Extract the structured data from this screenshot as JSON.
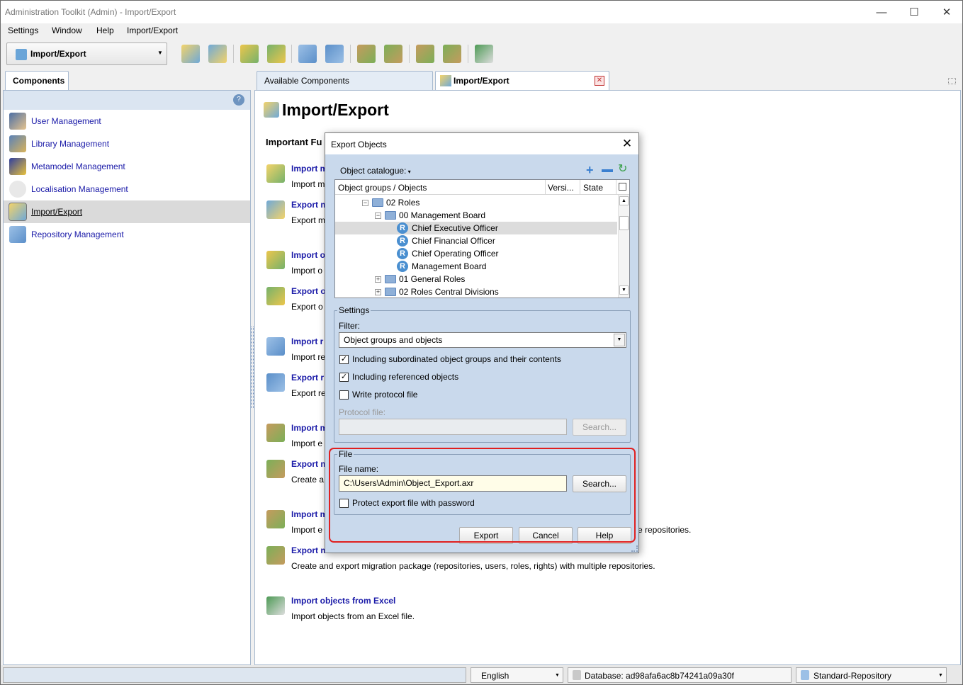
{
  "window": {
    "title": "Administration Toolkit (Admin) - Import/Export"
  },
  "menu": [
    "Settings",
    "Window",
    "Help",
    "Import/Export"
  ],
  "toolbar": {
    "perspective": "Import/Export"
  },
  "left": {
    "tab": "Components",
    "items": [
      "User Management",
      "Library Management",
      "Metamodel Management",
      "Localisation Management",
      "Import/Export",
      "Repository Management"
    ]
  },
  "tabs": {
    "available": "Available Components",
    "active": "Import/Export"
  },
  "main": {
    "title": "Import/Export",
    "section": "Important Fu",
    "functions": [
      {
        "link": "Import m",
        "desc": "Import m"
      },
      {
        "link": "Export m",
        "desc": "Export m"
      },
      {
        "link": "Import o",
        "desc": "Import o"
      },
      {
        "link": "Export o",
        "desc": "Export o"
      },
      {
        "link": "Import r",
        "desc": "Import re"
      },
      {
        "link": "Export r",
        "desc": "Export re"
      },
      {
        "link": "Import m",
        "desc": "Import e"
      },
      {
        "link": "Export m",
        "desc": "Create a"
      },
      {
        "link": "Import m",
        "desc": "Import e"
      },
      {
        "link": "Export m",
        "desc": "Create and export migration package (repositories, users, roles, rights) with multiple repositories."
      },
      {
        "link": "Import objects from Excel",
        "desc": "Import objects from an Excel file."
      }
    ],
    "desc_tail": "e repositories."
  },
  "status": {
    "language": "English",
    "database": "Database: ad98afa6ac8b74241a09a30f",
    "repository": "Standard-Repository"
  },
  "dialog": {
    "title": "Export Objects",
    "catalogue": "Object catalogue:",
    "columns": [
      "Object groups / Objects",
      "Versi...",
      "State"
    ],
    "tree": [
      {
        "label": "02 Roles",
        "kind": "folder",
        "level": 0
      },
      {
        "label": "00 Management Board",
        "kind": "folder",
        "level": 1
      },
      {
        "label": "Chief Executive Officer",
        "kind": "role",
        "level": 2
      },
      {
        "label": "Chief Financial Officer",
        "kind": "role",
        "level": 2
      },
      {
        "label": "Chief Operating Officer",
        "kind": "role",
        "level": 2
      },
      {
        "label": "Management Board",
        "kind": "role",
        "level": 2
      },
      {
        "label": "01 General Roles",
        "kind": "folder",
        "level": 1
      },
      {
        "label": "02 Roles Central Divisions",
        "kind": "folder",
        "level": 1
      }
    ],
    "settings": {
      "legend": "Settings",
      "filter_label": "Filter:",
      "filter_value": "Object groups and objects",
      "include_sub": "Including subordinated object groups and their contents",
      "include_ref": "Including referenced objects",
      "write_protocol": "Write protocol file",
      "protocol_label": "Protocol file:",
      "search": "Search..."
    },
    "file": {
      "legend": "File",
      "name_label": "File name:",
      "name_value": "C:\\Users\\Admin\\Object_Export.axr",
      "search": "Search...",
      "protect": "Protect export file with password"
    },
    "buttons": {
      "export": "Export",
      "cancel": "Cancel",
      "help": "Help"
    }
  }
}
